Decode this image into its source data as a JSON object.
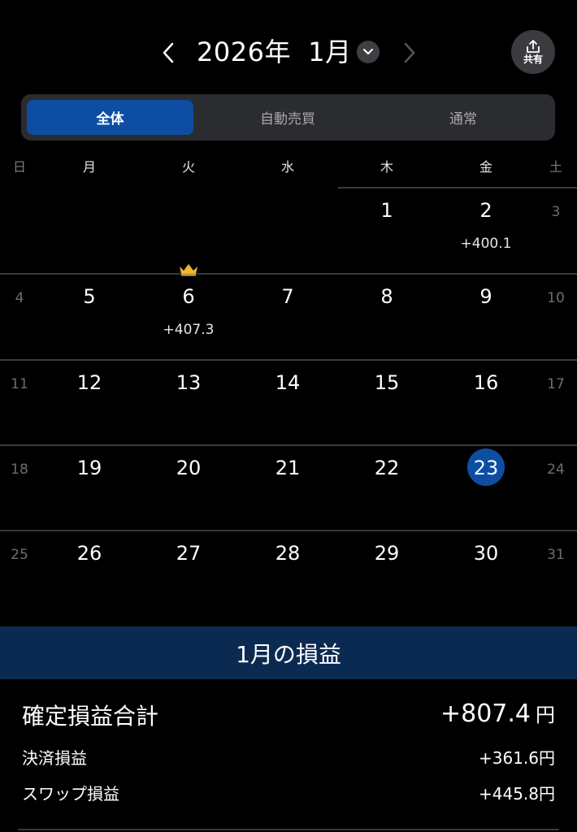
{
  "header": {
    "month_title": "2026年  1月",
    "share_label": "共有",
    "prev_icon": "chevron-left-icon",
    "next_icon": "chevron-right-icon",
    "dropdown_icon": "chevron-down-icon",
    "share_icon": "share-icon"
  },
  "segments": [
    {
      "label": "全体",
      "active": true
    },
    {
      "label": "自動売買",
      "active": false
    },
    {
      "label": "通常",
      "active": false
    }
  ],
  "weekdays": [
    "日",
    "月",
    "火",
    "水",
    "木",
    "金",
    "土"
  ],
  "weeks": [
    [
      null,
      null,
      null,
      null,
      {
        "day": "1"
      },
      {
        "day": "2",
        "pl": "+400.1"
      },
      {
        "day": "3"
      }
    ],
    [
      {
        "day": "4"
      },
      {
        "day": "5"
      },
      {
        "day": "6",
        "pl": "+407.3",
        "crown": true
      },
      {
        "day": "7"
      },
      {
        "day": "8"
      },
      {
        "day": "9"
      },
      {
        "day": "10"
      }
    ],
    [
      {
        "day": "11"
      },
      {
        "day": "12"
      },
      {
        "day": "13"
      },
      {
        "day": "14"
      },
      {
        "day": "15"
      },
      {
        "day": "16"
      },
      {
        "day": "17"
      }
    ],
    [
      {
        "day": "18"
      },
      {
        "day": "19"
      },
      {
        "day": "20"
      },
      {
        "day": "21"
      },
      {
        "day": "22"
      },
      {
        "day": "23",
        "today": true
      },
      {
        "day": "24"
      }
    ],
    [
      {
        "day": "25"
      },
      {
        "day": "26"
      },
      {
        "day": "27"
      },
      {
        "day": "28"
      },
      {
        "day": "29"
      },
      {
        "day": "30"
      },
      {
        "day": "31"
      }
    ]
  ],
  "summary": {
    "title": "1月の損益",
    "total_label": "確定損益合計",
    "total_value": "+807.4",
    "total_unit": "円",
    "settle_label": "決済損益",
    "settle_value": "+361.6円",
    "swap_label": "スワップ損益",
    "swap_value": "+445.8円"
  },
  "colors": {
    "accent": "#0d4ea3",
    "summary_bar": "#0a2a52",
    "crown": "#f2b632"
  }
}
